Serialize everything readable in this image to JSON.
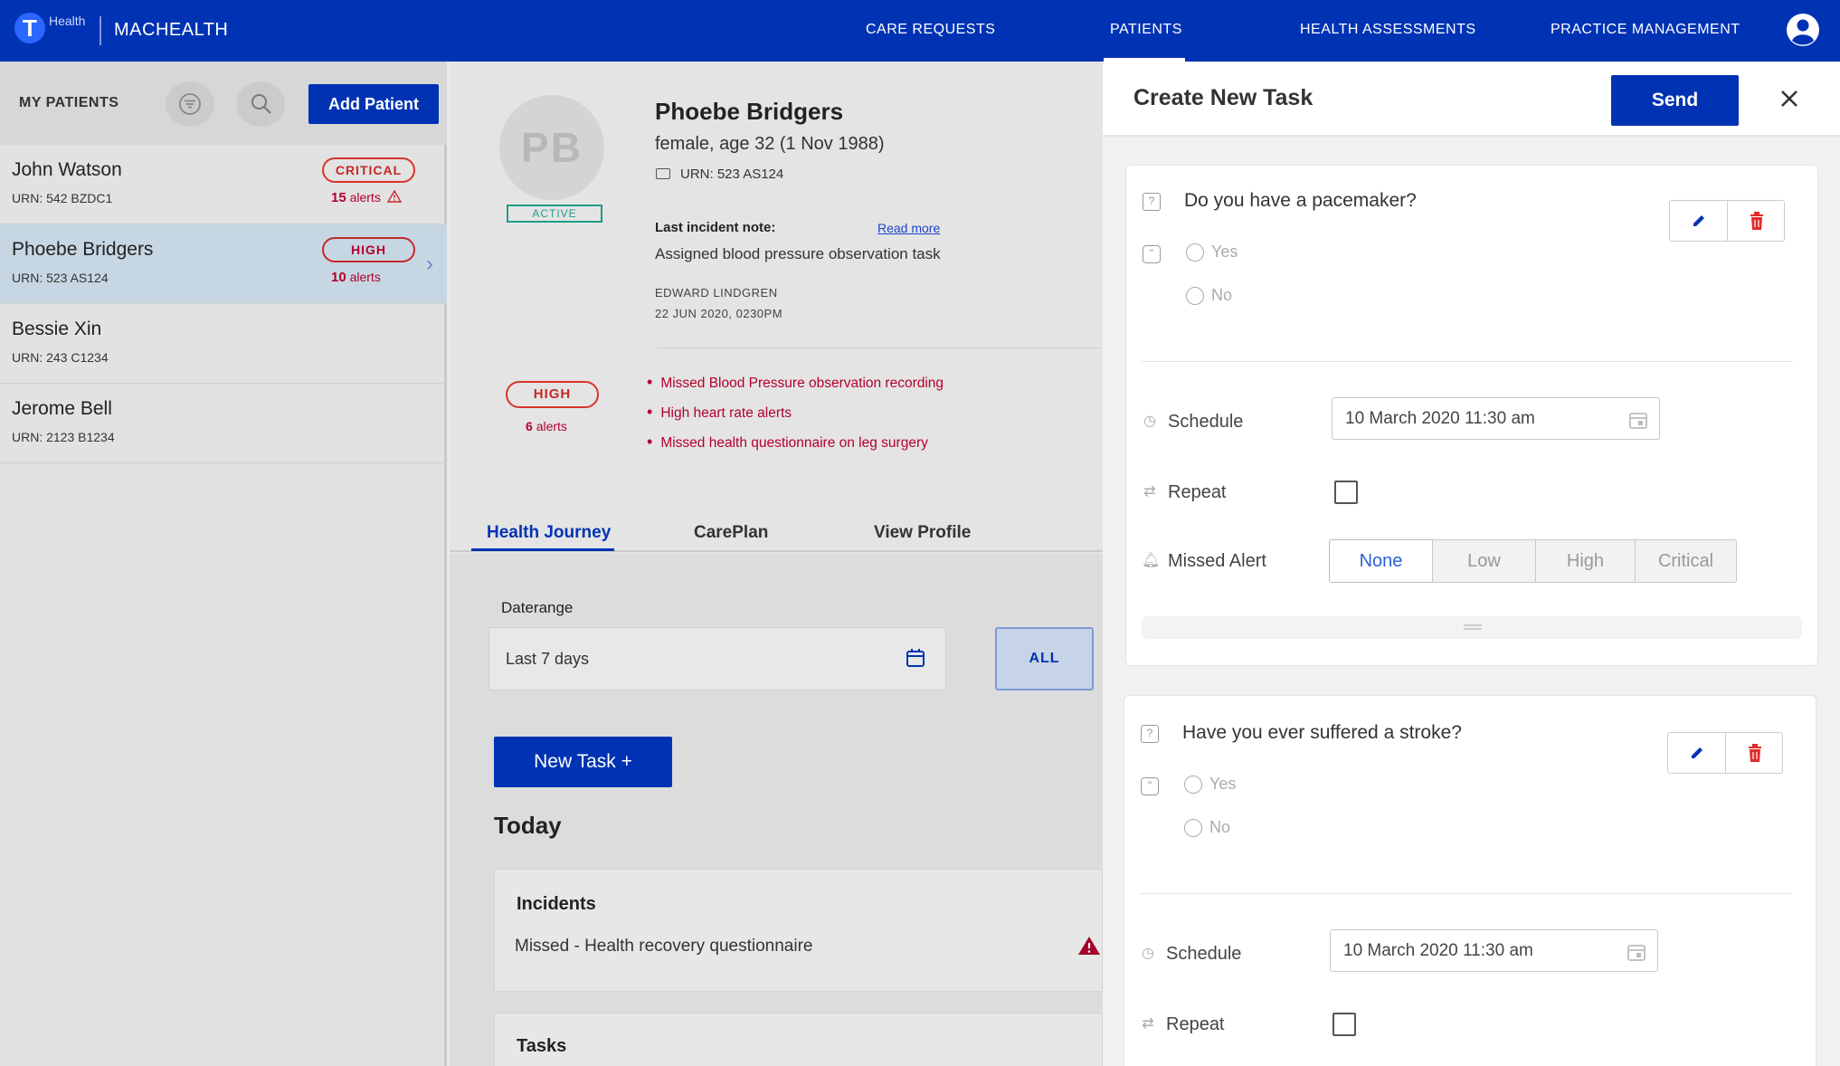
{
  "topnav": {
    "logo_small": "Health",
    "brand": "MACHEALTH",
    "items": [
      {
        "label": "CARE REQUESTS"
      },
      {
        "label": "PATIENTS"
      },
      {
        "label": "HEALTH ASSESSMENTS"
      },
      {
        "label": "PRACTICE MANAGEMENT"
      }
    ],
    "active_item": "PATIENTS"
  },
  "sidebar": {
    "title": "MY PATIENTS",
    "add_label": "Add Patient",
    "patients": [
      {
        "name": "John Watson",
        "urn": "URN: 542 BZDC1",
        "badge": "CRITICAL",
        "alert_count": "15",
        "alert_word": "alerts"
      },
      {
        "name": "Phoebe Bridgers",
        "urn": "URN: 523 AS124",
        "badge": "HIGH",
        "alert_count": "10",
        "alert_word": "alerts",
        "selected": true
      },
      {
        "name": "Bessie Xin",
        "urn": "URN: 243 C1234"
      },
      {
        "name": "Jerome Bell",
        "urn": "URN: 2123 B1234"
      }
    ]
  },
  "patient": {
    "initials": "PB",
    "status": "ACTIVE",
    "name": "Phoebe Bridgers",
    "details": "female, age 32 (1 Nov 1988)",
    "urn": "URN: 523 AS124",
    "incident_label": "Last incident note:",
    "read_more": "Read more",
    "incident_text": "Assigned blood pressure observation task",
    "author": "EDWARD LINDGREN",
    "date": "22 JUN 2020, 0230PM",
    "priority": "HIGH",
    "alert_count": "6",
    "alert_word": "alerts",
    "alerts": [
      "Missed Blood Pressure observation recording",
      "High heart rate alerts",
      "Missed health questionnaire on leg surgery"
    ]
  },
  "tabs": [
    {
      "label": "Health Journey"
    },
    {
      "label": "CarePlan"
    },
    {
      "label": "View Profile"
    }
  ],
  "journey": {
    "daterange_label": "Daterange",
    "daterange_value": "Last 7 days",
    "all_label": "ALL",
    "new_task_label": "New Task +",
    "today_label": "Today",
    "incidents_title": "Incidents",
    "incident_item": "Missed - Health recovery questionnaire",
    "tasks_title": "Tasks"
  },
  "task_panel": {
    "title": "Create New Task",
    "send_label": "Send",
    "questions": [
      {
        "text": "Do you have a pacemaker?",
        "options": [
          "Yes",
          "No"
        ],
        "schedule_label": "Schedule",
        "schedule_value": "10 March 2020 11:30 am",
        "repeat_label": "Repeat",
        "missed_alert_label": "Missed Alert",
        "missed_alert_options": [
          "None",
          "Low",
          "High",
          "Critical"
        ],
        "missed_alert_selected": "None"
      },
      {
        "text": "Have you ever suffered a stroke?",
        "options": [
          "Yes",
          "No"
        ],
        "schedule_label": "Schedule",
        "schedule_value": "10 March 2020 11:30 am",
        "repeat_label": "Repeat"
      }
    ]
  },
  "colors": {
    "primary": "#0033b3",
    "critical": "#d9332a",
    "alert_text": "#b3002d",
    "active_green": "#1f9c8a",
    "selected_row": "#c6d7e3"
  }
}
